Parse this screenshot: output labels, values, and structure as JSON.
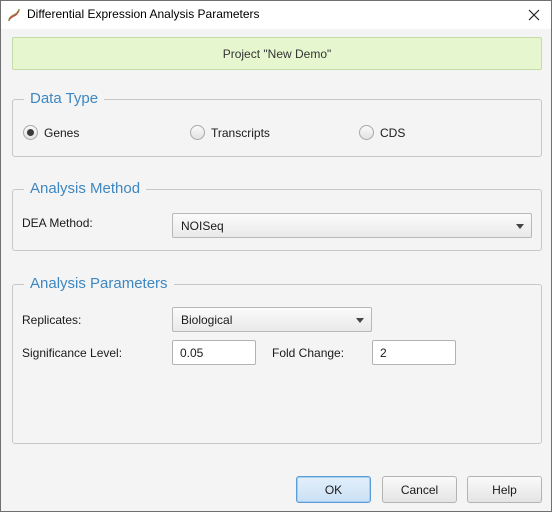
{
  "window": {
    "title": "Differential Expression Analysis Parameters"
  },
  "banner": {
    "text": "Project \"New Demo\""
  },
  "data_type": {
    "title": "Data Type",
    "options": [
      {
        "label": "Genes",
        "selected": true
      },
      {
        "label": "Transcripts",
        "selected": false
      },
      {
        "label": "CDS",
        "selected": false
      }
    ]
  },
  "analysis_method": {
    "title": "Analysis Method",
    "dea_label": "DEA Method:",
    "dea_value": "NOISeq"
  },
  "analysis_params": {
    "title": "Analysis Parameters",
    "replicates_label": "Replicates:",
    "replicates_value": "Biological",
    "significance_label": "Significance Level:",
    "significance_value": "0.05",
    "fold_change_label": "Fold Change:",
    "fold_change_value": "2"
  },
  "buttons": {
    "ok": "OK",
    "cancel": "Cancel",
    "help": "Help"
  },
  "colors": {
    "banner_bg": "#e6f7cf",
    "group_title": "#3e87c0",
    "default_button": "#c9e0f5"
  },
  "icons": {
    "app": "app-logo-icon",
    "close": "close-icon",
    "dropdown": "chevron-down-icon"
  }
}
